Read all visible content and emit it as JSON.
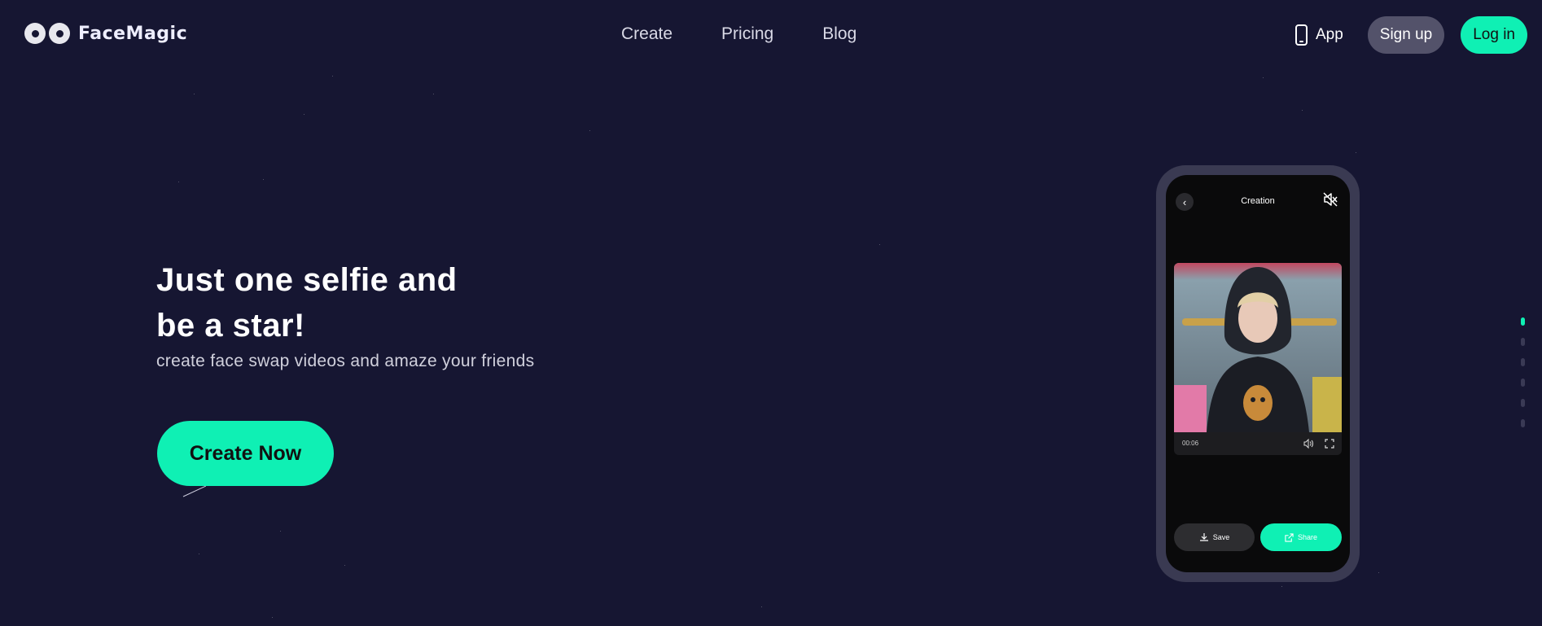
{
  "header": {
    "brand": "FaceMagic",
    "nav": [
      {
        "label": "Create"
      },
      {
        "label": "Pricing"
      },
      {
        "label": "Blog"
      }
    ],
    "app_label": "App",
    "signup_label": "Sign up",
    "login_label": "Log in"
  },
  "hero": {
    "title_line1": "Just one selfie and",
    "title_line2": "be a star!",
    "subtitle": "create face swap videos and amaze your friends",
    "cta_label": "Create Now"
  },
  "phone": {
    "screen_title": "Creation",
    "video_time": "00:06",
    "save_label": "Save",
    "share_label": "Share",
    "icons": [
      "back-icon",
      "mute-icon",
      "volume-icon",
      "fullscreen-icon",
      "download-icon",
      "share-icon"
    ]
  },
  "pager": {
    "count": 6,
    "active_index": 0
  },
  "colors": {
    "background": "#161632",
    "accent": "#0ff0b4",
    "signup_bg": "#53526a",
    "phone_frame": "#3a3a52"
  }
}
